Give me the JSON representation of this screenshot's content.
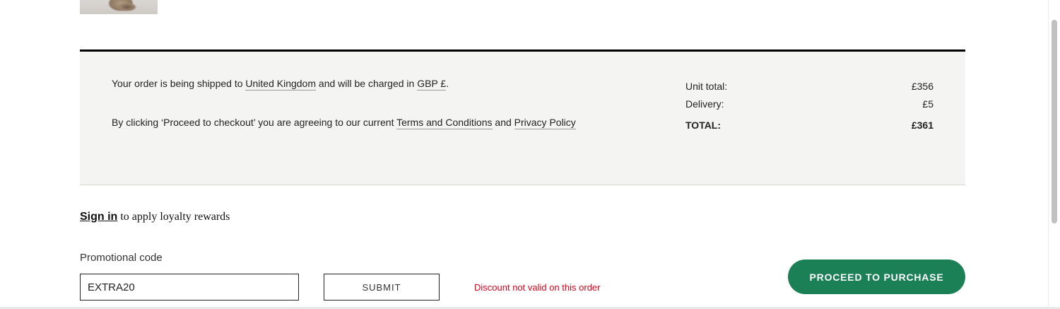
{
  "product": {
    "thumbnail_icon": "shoe-product-image"
  },
  "shipping_notice": {
    "prefix": "Your order is being shipped to ",
    "country": "United Kingdom",
    "middle": " and will be charged in ",
    "currency": "GBP £",
    "suffix": "."
  },
  "terms_notice": {
    "prefix": "By clicking ‘Proceed to checkout’ you are agreeing to our current ",
    "terms_link": "Terms and Conditions",
    "middle": " and ",
    "privacy_link": "Privacy Policy"
  },
  "totals": {
    "unit_total_label": "Unit total:",
    "unit_total_value": "£356",
    "delivery_label": "Delivery:",
    "delivery_value": "£5",
    "total_label": "TOTAL:",
    "total_value": "£361"
  },
  "loyalty": {
    "sign_in_link": "Sign in",
    "text": " to apply loyalty rewards"
  },
  "promo": {
    "label": "Promotional code",
    "input_value": "EXTRA20",
    "submit_label": "SUBMIT",
    "error_message": "Discount not valid on this order"
  },
  "actions": {
    "proceed_label": "PROCEED TO PURCHASE"
  },
  "colors": {
    "accent": "#1b8055",
    "error": "#e0001b",
    "panel_background": "#f4f4f3"
  }
}
